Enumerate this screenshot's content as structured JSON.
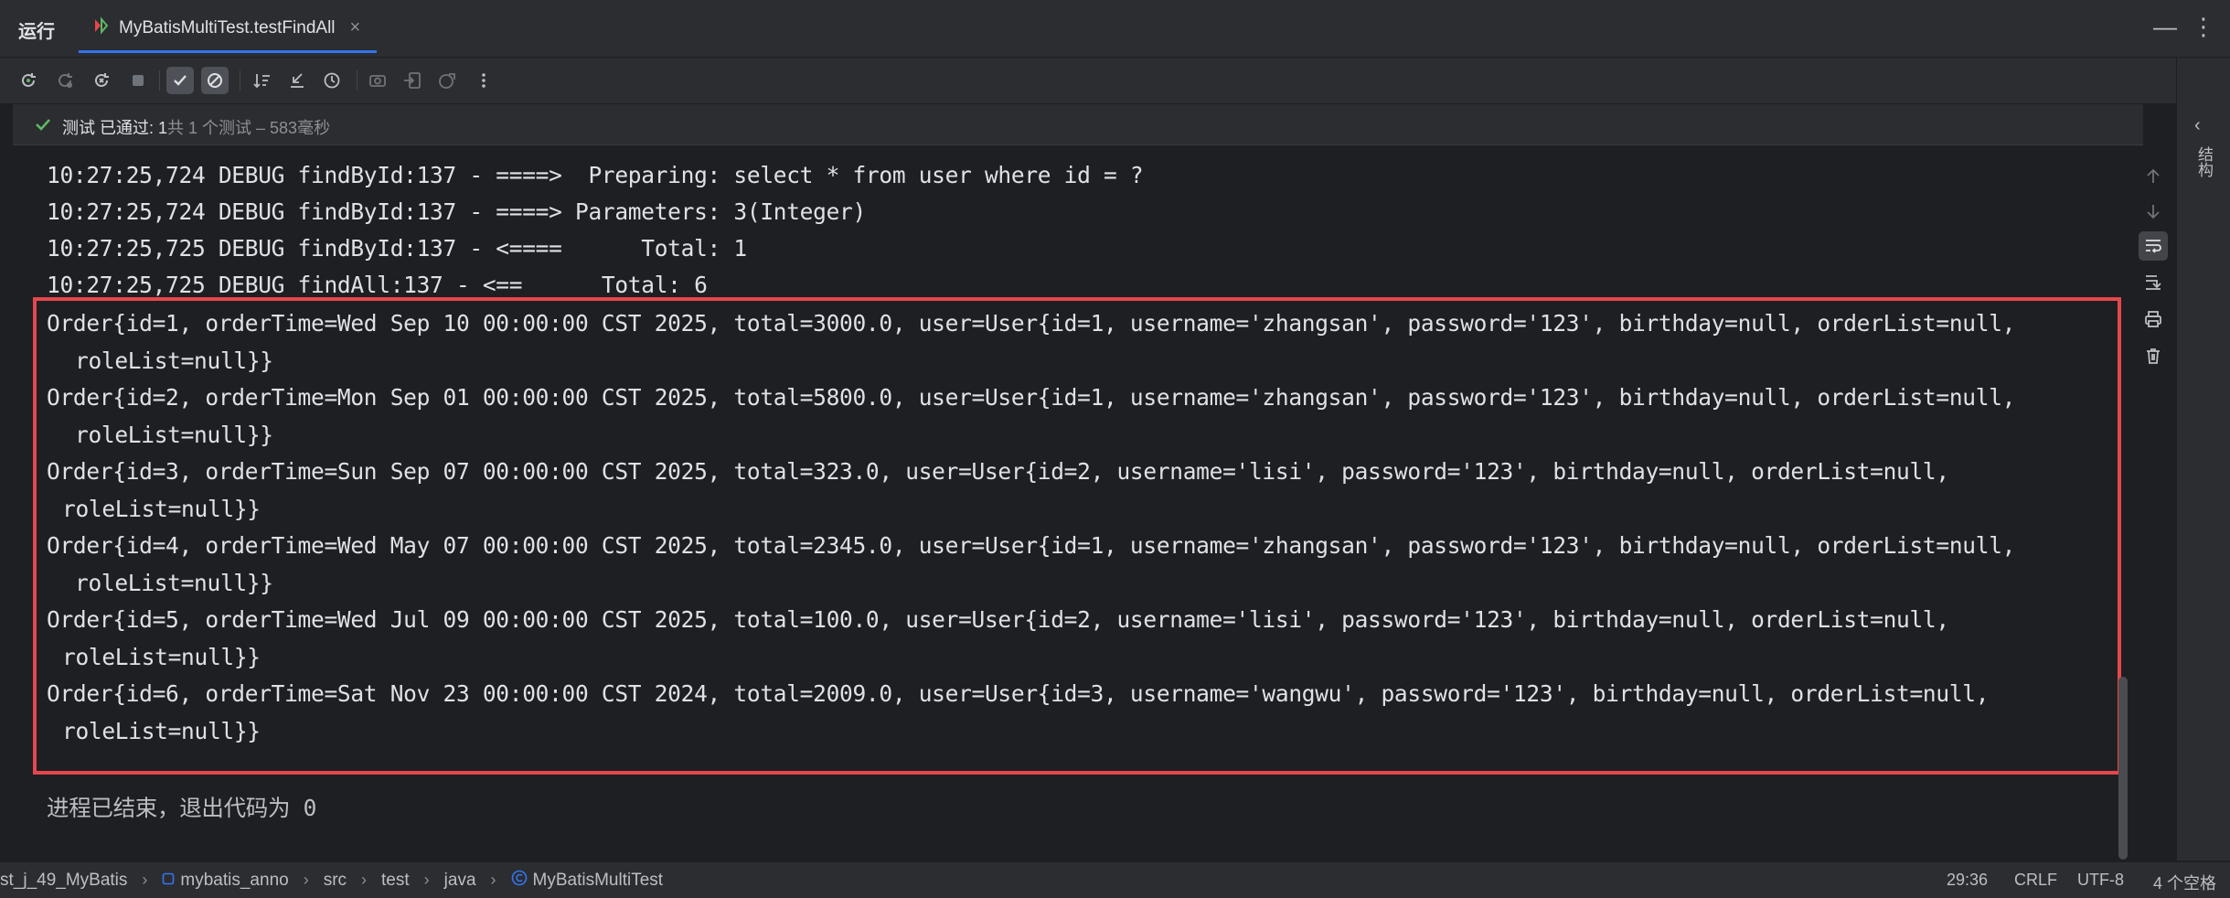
{
  "tabbar": {
    "run_label": "运行",
    "tab_title": "MyBatisMultiTest.testFindAll",
    "close_glyph": "×",
    "more_glyph": "⋮",
    "minimize_glyph": "—"
  },
  "status": {
    "label": "测试 已通过: 1",
    "detail": "共 1 个测试 – 583毫秒"
  },
  "console": {
    "lines": [
      "10:27:25,724 DEBUG findById:137 - ====>  Preparing: select * from user where id = ?",
      "10:27:25,724 DEBUG findById:137 - ====> Parameters: 3(Integer)",
      "10:27:25,725 DEBUG findById:137 - <====      Total: 1",
      "10:27:25,725 DEBUG findAll:137 - <==      Total: 6",
      "Order{id=1, orderTime=Wed Sep 10 00:00:00 CST 2025, total=3000.0, user=User{id=1, username='zhangsan', password='123', birthday=null, orderList=null,",
      "roleList=null}}",
      "Order{id=2, orderTime=Mon Sep 01 00:00:00 CST 2025, total=5800.0, user=User{id=1, username='zhangsan', password='123', birthday=null, orderList=null,",
      "roleList=null}}",
      "Order{id=3, orderTime=Sun Sep 07 00:00:00 CST 2025, total=323.0, user=User{id=2, username='lisi', password='123', birthday=null, orderList=null,",
      "roleList=null}}",
      "Order{id=4, orderTime=Wed May 07 00:00:00 CST 2025, total=2345.0, user=User{id=1, username='zhangsan', password='123', birthday=null, orderList=null,",
      "roleList=null}}",
      "Order{id=5, orderTime=Wed Jul 09 00:00:00 CST 2025, total=100.0, user=User{id=2, username='lisi', password='123', birthday=null, orderList=null,",
      "roleList=null}}",
      "Order{id=6, orderTime=Sat Nov 23 00:00:00 CST 2024, total=2009.0, user=User{id=3, username='wangwu', password='123', birthday=null, orderList=null,",
      "roleList=null}}",
      "进程已结束，退出代码为 0"
    ]
  },
  "side_panel": {
    "label": "结构",
    "chevron": "‹"
  },
  "breadcrumb": {
    "items": [
      "st_j_49_MyBatis",
      "mybatis_anno",
      "src",
      "test",
      "java",
      "MyBatisMultiTest"
    ],
    "separator": "›"
  },
  "statusbar": {
    "position": "29:36",
    "line_ending": "CRLF",
    "encoding": "UTF-8",
    "indent": "4 个空格"
  },
  "colors": {
    "background": "#1e1f22",
    "panel": "#2b2d30",
    "highlight_border": "#e5474d",
    "pass_green": "#5fb865",
    "accent": "#3574f0"
  },
  "icons": {
    "toolbar": [
      "rerun-icon",
      "rerun-failed-icon",
      "rerun-debug-icon",
      "stop-icon",
      "show-passed-icon",
      "show-ignored-icon",
      "sort-alpha-icon",
      "collapse-icon",
      "history-icon",
      "camera-icon",
      "import-icon",
      "export-icon",
      "more-icon"
    ],
    "right": [
      "scroll-up-icon",
      "scroll-down-icon",
      "soft-wrap-icon",
      "scroll-to-end-icon",
      "print-icon",
      "trash-icon"
    ]
  }
}
